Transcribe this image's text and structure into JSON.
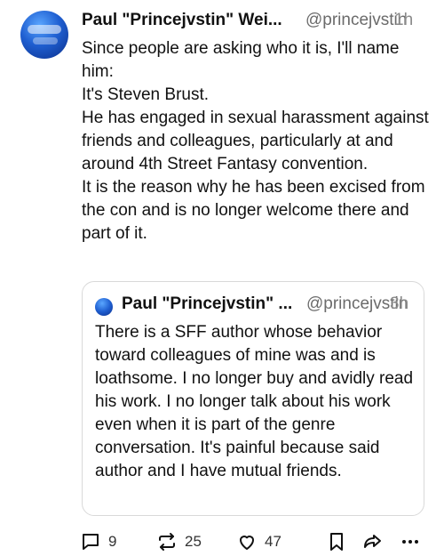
{
  "post": {
    "author_name": "Paul \"Princejvstin\" Wei...",
    "handle": "@princejvstin",
    "time": "1h",
    "body_lines": [
      "Since people are asking who it is, I'll name him:",
      "It's Steven Brust.",
      "He has engaged in sexual harassment against friends and colleagues, particularly at and around 4th Street Fantasy convention.",
      "It is the reason why he has been excised from the con and is no longer welcome there and part of it."
    ]
  },
  "quoted_post": {
    "author_name": "Paul \"Princejvstin\" ...",
    "handle": "@princejvstin",
    "time": "3h",
    "body": "There is a SFF author whose behavior toward colleagues of mine was and is loathsome. I no longer buy and avidly read his work. I no longer talk about his work even when it is part of the genre conversation. It's painful because said author and I have mutual friends."
  },
  "actions": {
    "replies": "9",
    "reposts": "25",
    "likes": "47"
  },
  "icons": [
    "reply-icon",
    "repost-icon",
    "like-icon",
    "bookmark-icon",
    "share-icon",
    "more-icon"
  ],
  "colors": {
    "text": "#111111",
    "muted": "#6b6b6b",
    "border": "#d9d9d9"
  }
}
